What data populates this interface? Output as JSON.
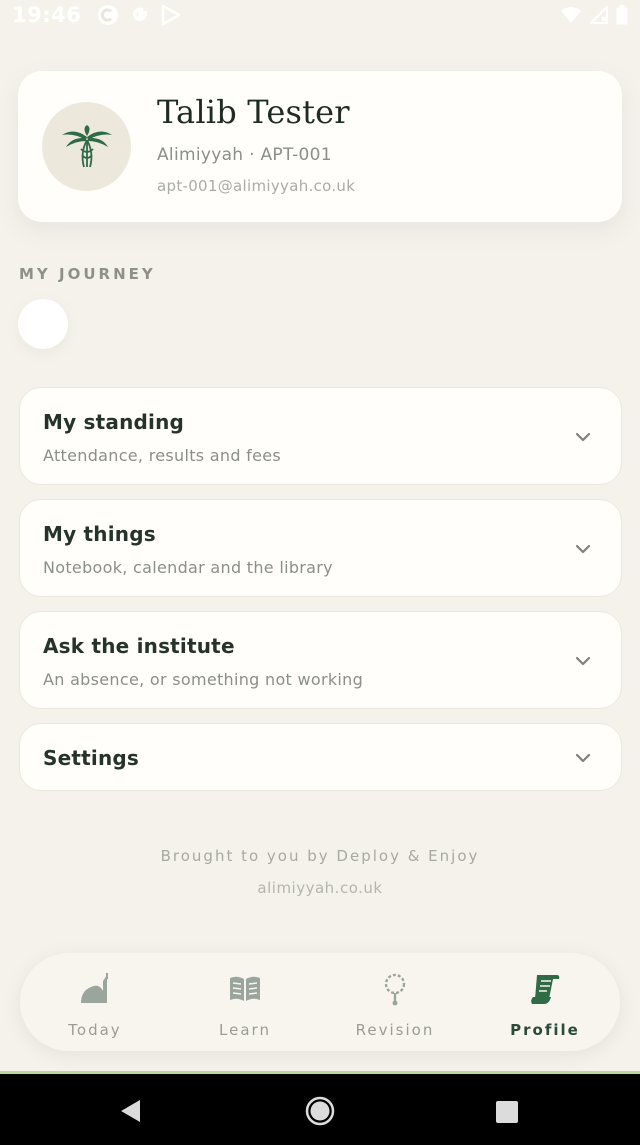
{
  "status_bar": {
    "time": "19:46",
    "left_icons": [
      "c-icon",
      "google-icon",
      "play-store-icon"
    ],
    "right_icons": [
      "wifi-icon",
      "signal-icon",
      "battery-icon"
    ]
  },
  "profile": {
    "name": "Talib Tester",
    "subtitle": "Alimiyyah · APT-001",
    "email": "apt-001@alimiyyah.co.uk",
    "avatar_icon": "palm-tree-icon"
  },
  "journey": {
    "label": "MY JOURNEY"
  },
  "sections": [
    {
      "title": "My standing",
      "subtitle": "Attendance, results and fees"
    },
    {
      "title": "My things",
      "subtitle": "Notebook, calendar and the library"
    },
    {
      "title": "Ask the institute",
      "subtitle": "An absence, or something not working"
    },
    {
      "title": "Settings",
      "subtitle": ""
    }
  ],
  "footer": {
    "credit": "Brought to you by Deploy & Enjoy",
    "site": "alimiyyah.co.uk"
  },
  "nav": {
    "items": [
      {
        "label": "Today",
        "icon": "mosque-icon"
      },
      {
        "label": "Learn",
        "icon": "book-icon"
      },
      {
        "label": "Revision",
        "icon": "prayer-beads-icon"
      },
      {
        "label": "Profile",
        "icon": "scroll-icon"
      }
    ],
    "active": "Profile"
  },
  "colors": {
    "background": "#f5f2ec",
    "card": "#fffefb",
    "accent": "#2f6b45",
    "text": "#25332a",
    "muted": "#8a8f87"
  }
}
